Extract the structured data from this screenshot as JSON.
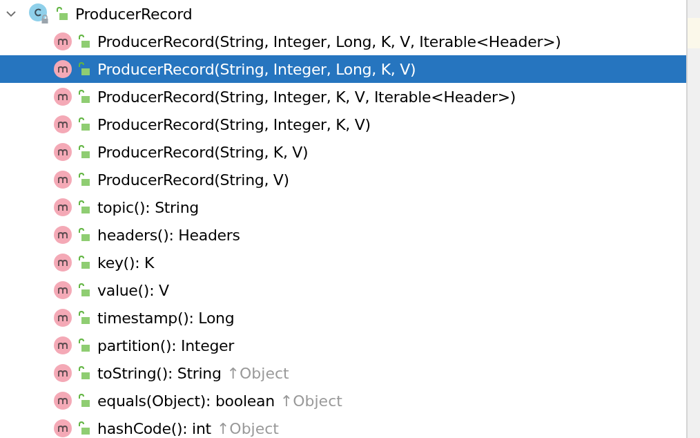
{
  "tree": {
    "label": "ProducerRecord",
    "expanded": true,
    "children": [
      {
        "label": "ProducerRecord(String, Integer, Long, K, V, Iterable<Header>)",
        "selected": false
      },
      {
        "label": "ProducerRecord(String, Integer, Long, K, V)",
        "selected": true
      },
      {
        "label": "ProducerRecord(String, Integer, K, V, Iterable<Header>)",
        "selected": false
      },
      {
        "label": "ProducerRecord(String, Integer, K, V)",
        "selected": false
      },
      {
        "label": "ProducerRecord(String, K, V)",
        "selected": false
      },
      {
        "label": "ProducerRecord(String, V)",
        "selected": false
      },
      {
        "label": "topic(): String",
        "selected": false
      },
      {
        "label": "headers(): Headers",
        "selected": false
      },
      {
        "label": "key(): K",
        "selected": false
      },
      {
        "label": "value(): V",
        "selected": false
      },
      {
        "label": "timestamp(): Long",
        "selected": false
      },
      {
        "label": "partition(): Integer",
        "selected": false
      },
      {
        "label": "toString(): String",
        "inherited": "↑Object",
        "selected": false
      },
      {
        "label": "equals(Object): boolean",
        "inherited": "↑Object",
        "selected": false
      },
      {
        "label": "hashCode(): int",
        "inherited": "↑Object",
        "selected": false
      }
    ]
  }
}
